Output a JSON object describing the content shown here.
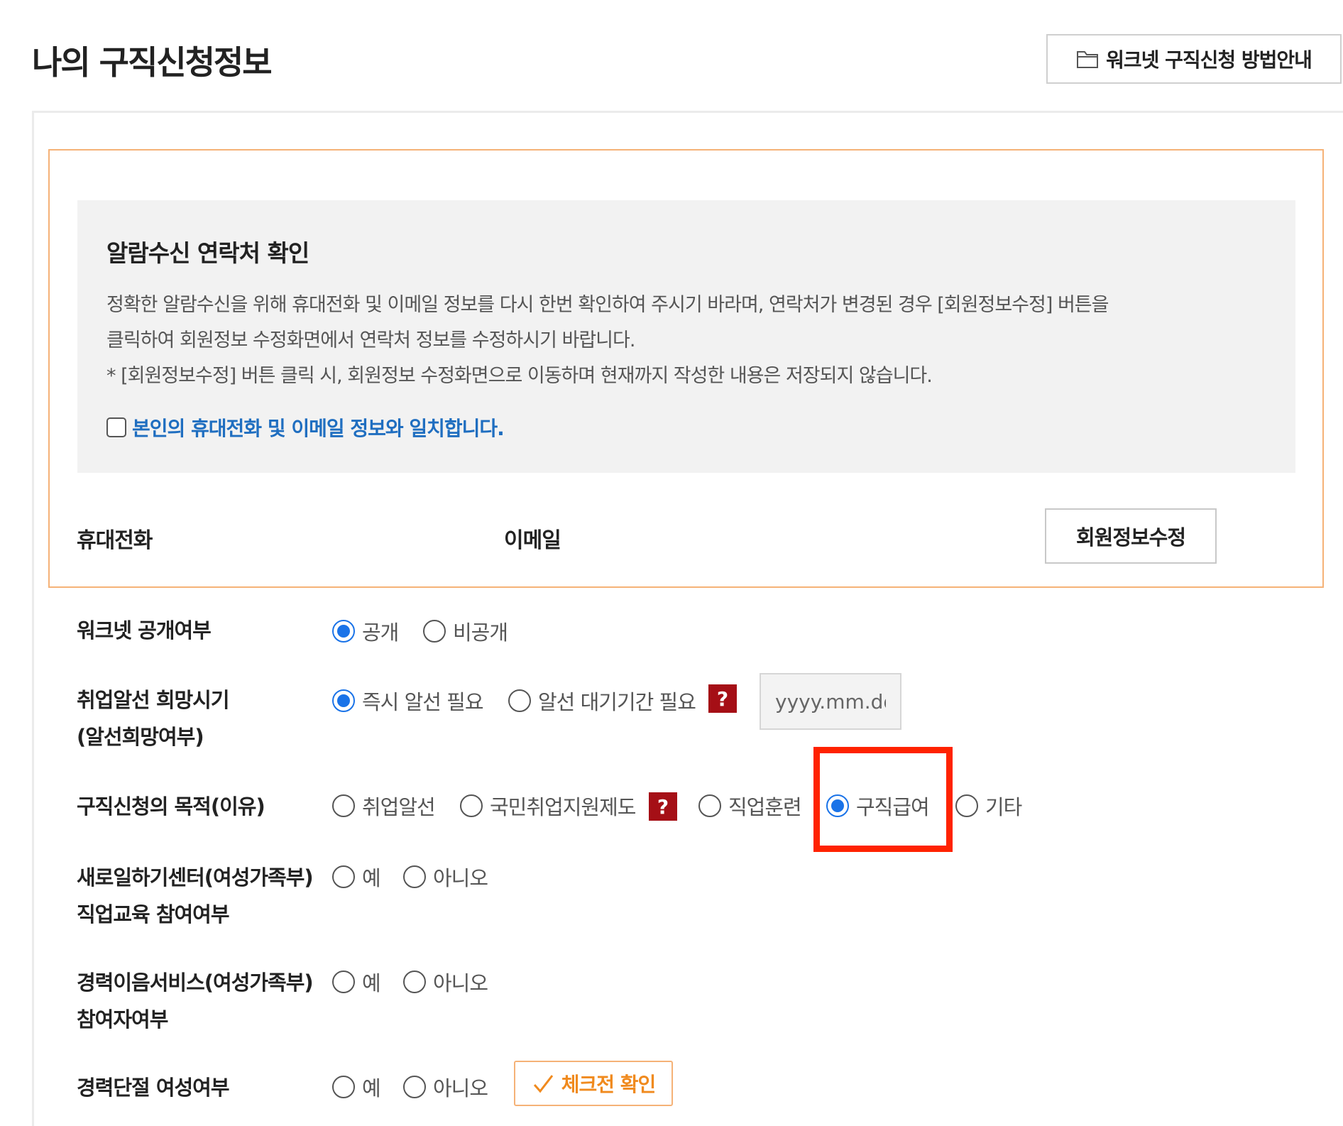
{
  "page": {
    "title": "나의 구직신청정보",
    "guide_button": "워크넷 구직신청 방법안내"
  },
  "alarm": {
    "title": "알람수신 연락처 확인",
    "desc_line1": "정확한 알람수신을 위해 휴대전화 및 이메일 정보를 다시 한번 확인하여 주시기 바라며, 연락처가 변경된 경우 [회원정보수정] 버튼을",
    "desc_line2": "클릭하여 회원정보 수정화면에서 연락처 정보를 수정하시기 바랍니다.",
    "desc_line3": "* [회원정보수정] 버튼 클릭 시, 회원정보 수정화면으로 이동하며 현재까지 작성한 내용은 저장되지 않습니다.",
    "confirm_label": "본인의 휴대전화 및 이메일 정보와 일치합니다."
  },
  "contact": {
    "phone_label": "휴대전화",
    "email_label": "이메일",
    "edit_button": "회원정보수정"
  },
  "form": {
    "worknet_public": {
      "label": "워크넷 공개여부",
      "options": [
        "공개",
        "비공개"
      ],
      "selected": "공개"
    },
    "placement_timing": {
      "label_line1": "취업알선 희망시기",
      "label_line2": "(알선희망여부)",
      "options": [
        "즉시 알선 필요",
        "알선 대기기간 필요"
      ],
      "selected": "즉시 알선 필요",
      "help": "?",
      "date_placeholder": "yyyy.mm.dd"
    },
    "purpose": {
      "label": "구직신청의 목적(이유)",
      "options": [
        "취업알선",
        "국민취업지원제도",
        "직업훈련",
        "구직급여",
        "기타"
      ],
      "selected": "구직급여",
      "help": "?"
    },
    "women_center": {
      "label_line1": "새로일하기센터(여성가족부)",
      "label_line2": "직업교육 참여여부",
      "options": [
        "예",
        "아니오"
      ]
    },
    "career_link": {
      "label_line1": "경력이음서비스(여성가족부)",
      "label_line2": "참여자여부",
      "options": [
        "예",
        "아니오"
      ]
    },
    "career_break": {
      "label": "경력단절 여성여부",
      "options": [
        "예",
        "아니오"
      ],
      "precheck_button": "체크전 확인"
    }
  },
  "colors": {
    "accent_orange": "#f08a1e",
    "border_orange": "#f5b277",
    "radio_blue": "#1a73e8",
    "help_red": "#a50f16",
    "link_blue": "#1f6ec0",
    "highlight_red": "#ff2200"
  }
}
